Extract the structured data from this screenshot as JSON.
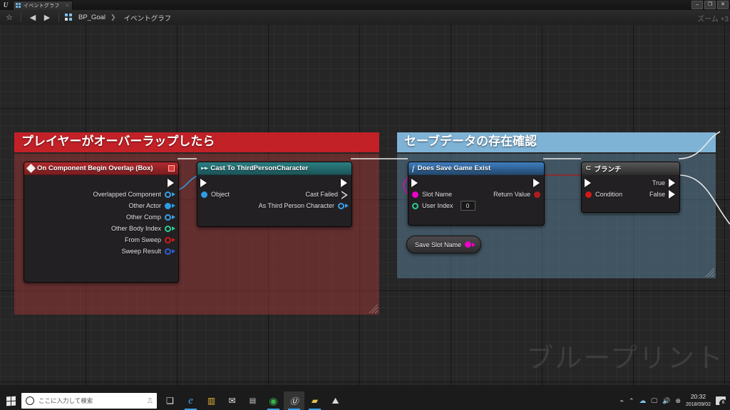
{
  "window": {
    "tab_label": "イベントグラフ",
    "tab_close": "×",
    "minimize": "–",
    "maximize": "❐",
    "close": "✕"
  },
  "toolbar": {
    "favorite_icon": "☆",
    "back_icon": "◀",
    "forward_icon": "▶",
    "breadcrumb_root": "BP_Goal",
    "breadcrumb_sep": "❯",
    "breadcrumb_current": "イベントグラフ",
    "zoom_label": "ズーム +3"
  },
  "canvas": {
    "watermark": "ブループリント"
  },
  "comments": [
    {
      "id": "overlap",
      "title": "プレイヤーがオーバーラップしたら",
      "header_color": "#c22127",
      "body_color": "rgba(150,52,52,.55)"
    },
    {
      "id": "save",
      "title": "セーブデータの存在確認",
      "header_color": "#7fb3d6",
      "body_color": "rgba(92,130,156,.50)"
    }
  ],
  "nodes": {
    "overlap": {
      "title": "On Component Begin Overlap (Box)",
      "header_color": "#b02a2d",
      "pins": [
        {
          "label": "Overlapped Component",
          "type": "object",
          "color": "#3aa0e8"
        },
        {
          "label": "Other Actor",
          "type": "object-filled",
          "color": "#2e9ce6"
        },
        {
          "label": "Other Comp",
          "type": "object",
          "color": "#3aa0e8"
        },
        {
          "label": "Other Body Index",
          "type": "int",
          "color": "#2ecc8f"
        },
        {
          "label": "From Sweep",
          "type": "bool",
          "color": "#d01a1a"
        },
        {
          "label": "Sweep Result",
          "type": "struct",
          "color": "#2d5fd8"
        }
      ]
    },
    "cast": {
      "title": "Cast To ThirdPersonCharacter",
      "header_color": "#2c7e82",
      "input_pin": {
        "label": "Object",
        "color": "#2e9ce6"
      },
      "output_pins": [
        {
          "label": "Cast Failed",
          "type": "exec-hollow"
        },
        {
          "label": "As Third Person Character",
          "type": "object",
          "color": "#3aa0e8"
        }
      ]
    },
    "exist": {
      "title": "Does Save Game Exist",
      "header_color": "#3f7fc1",
      "input_pins": [
        {
          "label": "Slot Name",
          "type": "string",
          "color": "#ee00c8"
        },
        {
          "label": "User Index",
          "type": "int",
          "color": "#2ecc8f",
          "value": "0"
        }
      ],
      "output_pins": [
        {
          "label": "Return Value",
          "type": "bool",
          "color": "#b01c1c"
        }
      ]
    },
    "branch": {
      "title": "ブランチ",
      "header_color": "#575757",
      "input_pins": [
        {
          "label": "Condition",
          "type": "bool",
          "color": "#d01a1a"
        }
      ],
      "output_pins": [
        {
          "label": "True",
          "type": "exec"
        },
        {
          "label": "False",
          "type": "exec"
        }
      ]
    },
    "variable": {
      "label": "Save Slot Name",
      "pin_color": "#ee00c8"
    }
  },
  "taskbar": {
    "search_placeholder": "ここに入力して検索",
    "mic_icon": "🎤",
    "apps": [
      {
        "name": "task-view",
        "glyph": "❑"
      },
      {
        "name": "edge",
        "glyph": "e"
      },
      {
        "name": "microsoft-store",
        "glyph": "▥"
      },
      {
        "name": "mail",
        "glyph": "✉"
      },
      {
        "name": "visual-studio-code",
        "glyph": "▤"
      },
      {
        "name": "chrome",
        "glyph": "◉"
      },
      {
        "name": "unreal-engine",
        "glyph": "U"
      },
      {
        "name": "file-explorer",
        "glyph": "▰"
      },
      {
        "name": "photos",
        "glyph": "⛰"
      }
    ],
    "tray": {
      "pen_icon": "⌁",
      "chevron_icon": "⌃",
      "onedrive_icon": "☁",
      "network_icon": "🖵",
      "volume_icon": "🔊",
      "shield_icon": "⊗",
      "time": "20:32",
      "date": "2018/09/02",
      "notification_count": "6"
    }
  }
}
